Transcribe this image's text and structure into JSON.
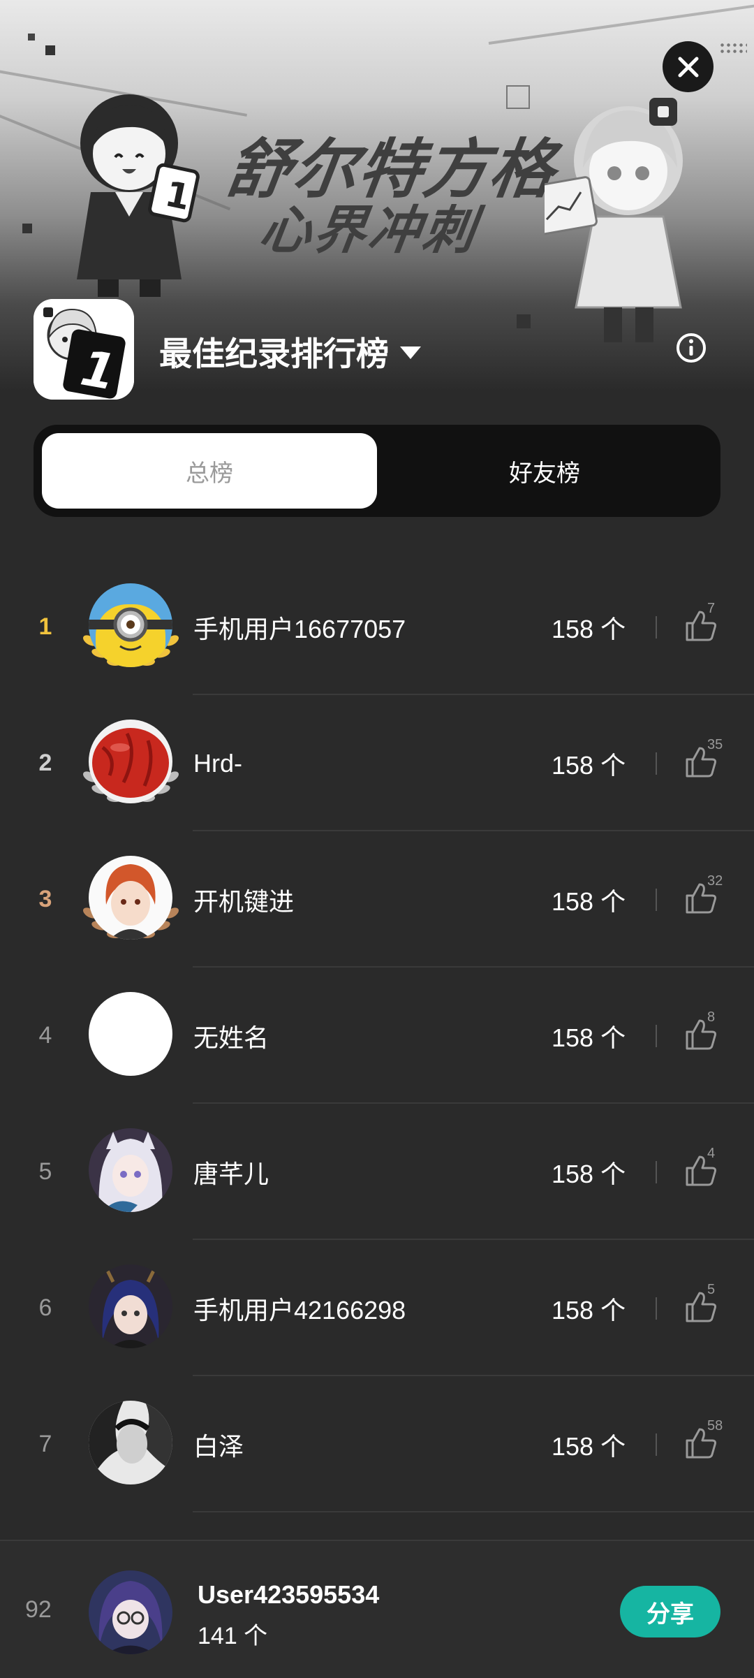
{
  "banner": {
    "title_line1": "舒尔特方格",
    "title_line2": "心界冲刺"
  },
  "header": {
    "title": "最佳纪录排行榜"
  },
  "tabs": [
    {
      "label": "总榜",
      "active": true
    },
    {
      "label": "好友榜",
      "active": false
    }
  ],
  "leaderboard": [
    {
      "rank": "1",
      "name": "手机用户16677057",
      "score": "158 个",
      "likes": "7",
      "avatar": "minion-avatar",
      "medal": "gold"
    },
    {
      "rank": "2",
      "name": "Hrd-",
      "score": "158 个",
      "likes": "35",
      "avatar": "red-date-avatar",
      "medal": "silver"
    },
    {
      "rank": "3",
      "name": "开机键进",
      "score": "158 个",
      "likes": "32",
      "avatar": "anime-redhair-avatar",
      "medal": "bronze"
    },
    {
      "rank": "4",
      "name": "无姓名",
      "score": "158 个",
      "likes": "8",
      "avatar": "blank-avatar",
      "medal": "none"
    },
    {
      "rank": "5",
      "name": "唐芊儿",
      "score": "158 个",
      "likes": "4",
      "avatar": "anime-whitehair-avatar",
      "medal": "none"
    },
    {
      "rank": "6",
      "name": "手机用户42166298",
      "score": "158 个",
      "likes": "5",
      "avatar": "anime-darkhair-avatar",
      "medal": "none"
    },
    {
      "rank": "7",
      "name": "白泽",
      "score": "158 个",
      "likes": "58",
      "avatar": "monochrome-avatar",
      "medal": "none"
    }
  ],
  "me": {
    "rank": "92",
    "name": "User423595534",
    "score": "141 个",
    "share_label": "分享"
  },
  "colors": {
    "background": "#2a2a2a",
    "gold": "#f1c33d",
    "silver": "#cfcfcf",
    "bronze": "#d9a37a",
    "share": "#16b5a2"
  }
}
